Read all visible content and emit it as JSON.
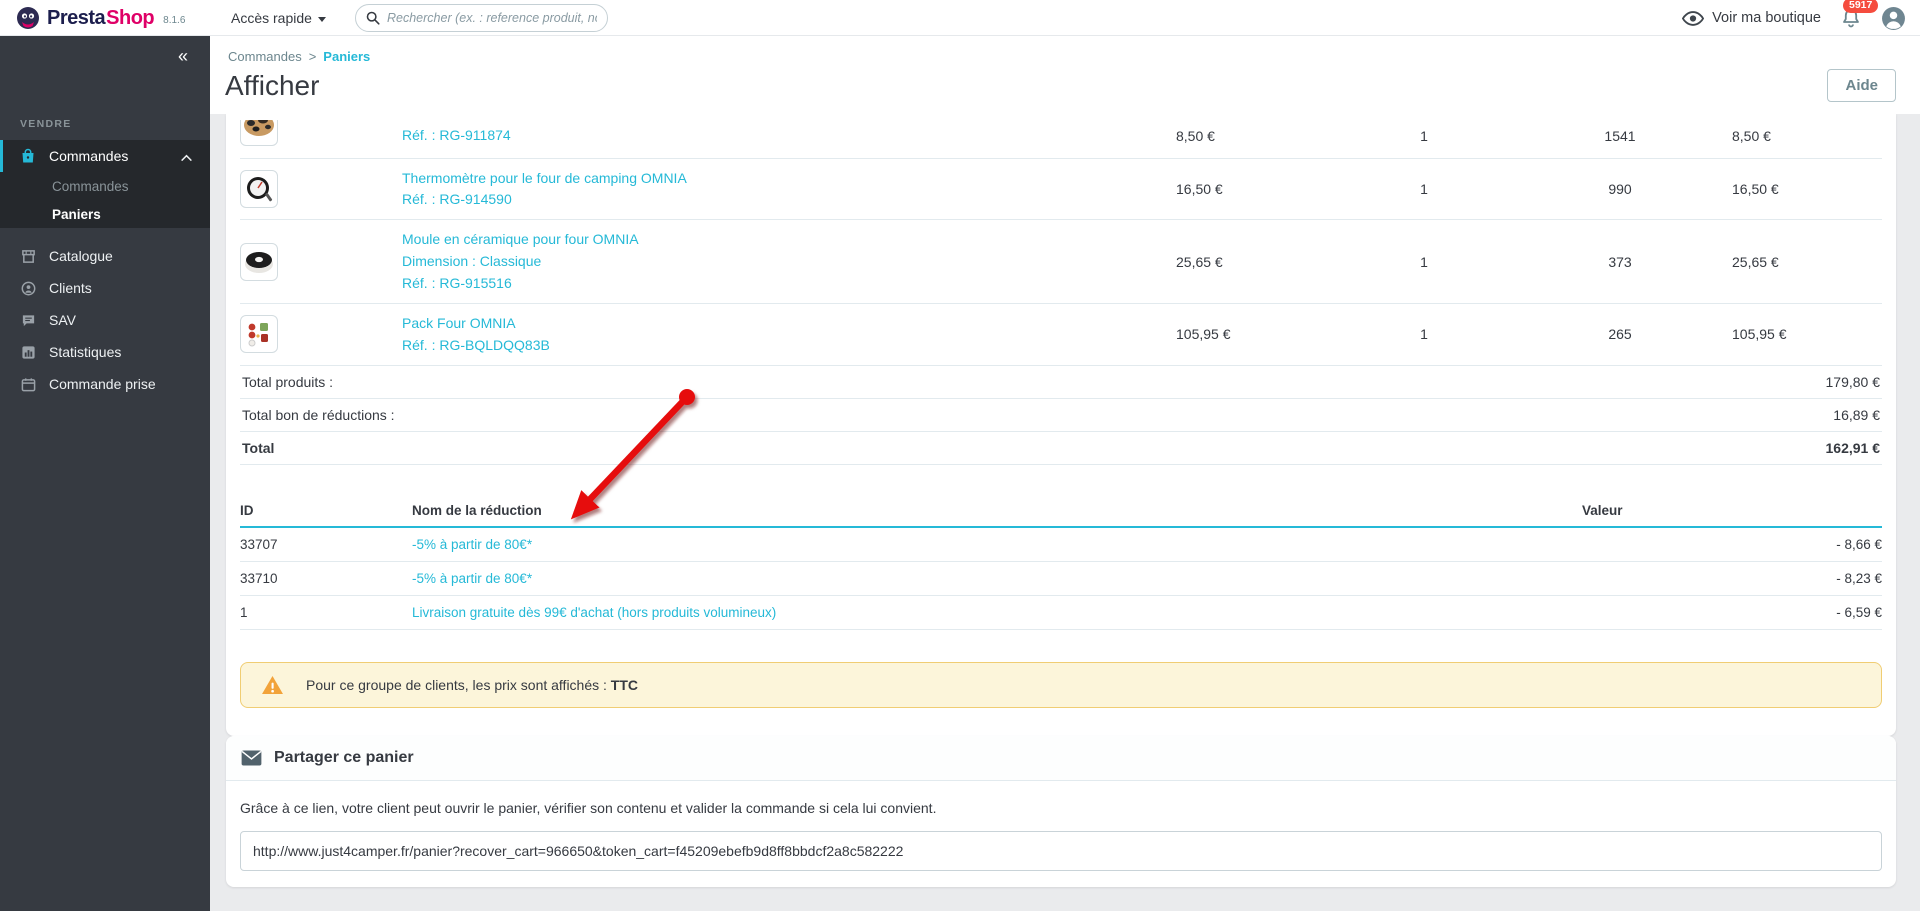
{
  "colors": {
    "accent": "#25b9d7",
    "badge": "#f54c3e",
    "arrow": "#e60b0b",
    "warning_bg": "#fcf5da"
  },
  "topbar": {
    "brand_presta": "Presta",
    "brand_shop": "Shop",
    "version": "8.1.6",
    "quick_access": "Accès rapide",
    "search_placeholder": "Rechercher (ex. : reference produit, no",
    "view_shop": "Voir ma boutique",
    "notifications": "5917"
  },
  "sidebar": {
    "collapse": "«",
    "section": "VENDRE",
    "commandes": {
      "label": "Commandes",
      "submenu": [
        {
          "label": "Commandes"
        },
        {
          "label": "Paniers"
        }
      ]
    },
    "items": [
      {
        "label": "Catalogue"
      },
      {
        "label": "Clients"
      },
      {
        "label": "SAV"
      },
      {
        "label": "Statistiques"
      },
      {
        "label": "Commande prise"
      }
    ]
  },
  "header": {
    "breadcrumb_parent": "Commandes",
    "breadcrumb_sep": ">",
    "breadcrumb_current": "Paniers",
    "title": "Afficher",
    "help": "Aide"
  },
  "cart": {
    "rows": [
      {
        "name": "",
        "variant": "",
        "ref": "Réf. : RG-911874",
        "price": "8,50 €",
        "qty": "1",
        "stock": "1541",
        "total": "8,50 €"
      },
      {
        "name": "Thermomètre pour le four de camping OMNIA",
        "variant": "",
        "ref": "Réf. : RG-914590",
        "price": "16,50 €",
        "qty": "1",
        "stock": "990",
        "total": "16,50 €"
      },
      {
        "name": "Moule en céramique pour four OMNIA",
        "variant": "Dimension : Classique",
        "ref": "Réf. : RG-915516",
        "price": "25,65 €",
        "qty": "1",
        "stock": "373",
        "total": "25,65 €"
      },
      {
        "name": "Pack Four OMNIA",
        "variant": "",
        "ref": "Réf. : RG-BQLDQQ83B",
        "price": "105,95 €",
        "qty": "1",
        "stock": "265",
        "total": "105,95 €"
      }
    ],
    "totals": [
      {
        "label": "Total produits :",
        "value": "179,80 €"
      },
      {
        "label": "Total bon de réductions :",
        "value": "16,89 €"
      },
      {
        "label": "Total",
        "value": "162,91 €"
      }
    ]
  },
  "reductions": {
    "col_id": "ID",
    "col_name": "Nom de la réduction",
    "col_value": "Valeur",
    "rows": [
      {
        "id": "33707",
        "name": "-5% à partir de 80€*",
        "value": "- 8,66 €"
      },
      {
        "id": "33710",
        "name": "-5% à partir de 80€*",
        "value": "- 8,23 €"
      },
      {
        "id": "1",
        "name": "Livraison gratuite dès 99€ d'achat (hors produits volumineux)",
        "value": "- 6,59 €"
      }
    ]
  },
  "warning": {
    "text": "Pour ce groupe de clients, les prix sont affichés :",
    "bold": "TTC"
  },
  "share": {
    "title": "Partager ce panier",
    "description": "Grâce à ce lien, votre client peut ouvrir le panier, vérifier son contenu et valider la commande si cela lui convient.",
    "url": "http://www.just4camper.fr/panier?recover_cart=966650&token_cart=f45209ebefb9d8ff8bbdcf2a8c582222"
  }
}
